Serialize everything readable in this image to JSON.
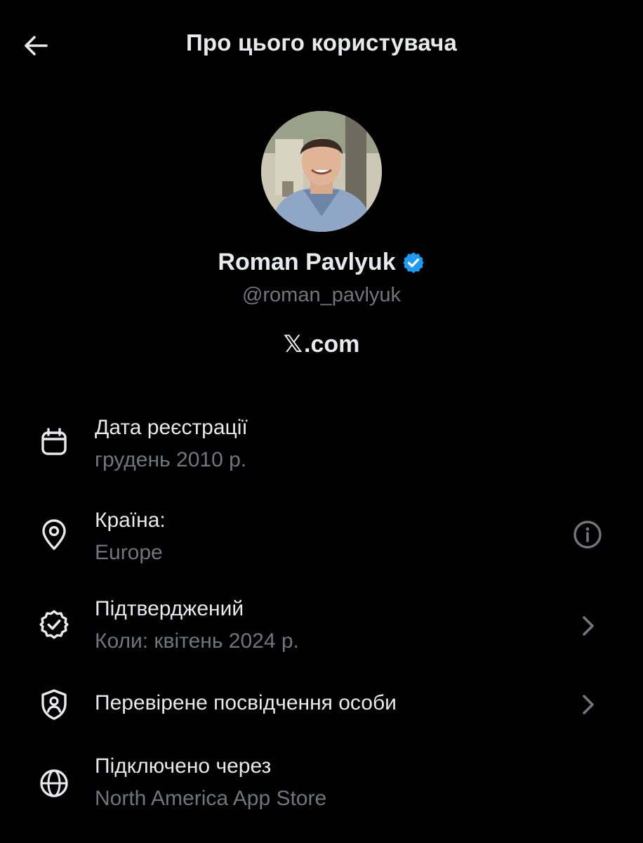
{
  "header": {
    "title": "Про цього користувача",
    "back_icon": "arrow-left-icon"
  },
  "profile": {
    "name": "Roman Pavlyuk",
    "verified_badge": "verified-checkmark-icon",
    "handle": "@roman_pavlyuk",
    "platform_logo": "𝕏",
    "platform_suffix": ".com"
  },
  "info": {
    "items": [
      {
        "icon": "calendar-icon",
        "title": "Дата реєстрації",
        "subtitle": "грудень 2010 р."
      },
      {
        "icon": "location-pin-icon",
        "title": "Країна:",
        "subtitle": "Europe",
        "action_icon": "info-icon"
      },
      {
        "icon": "verified-badge-icon",
        "title": "Підтверджений",
        "subtitle": "Коли: квітень 2024 р.",
        "action_icon": "chevron-right-icon"
      },
      {
        "icon": "id-shield-icon",
        "title": "Перевірене посвідчення особи",
        "action_icon": "chevron-right-icon"
      },
      {
        "icon": "globe-icon",
        "title": "Підключено через",
        "subtitle": "North America App Store"
      }
    ]
  },
  "colors": {
    "background": "#000000",
    "primary_text": "#e7e9ea",
    "secondary_text": "#71767b",
    "verified_blue": "#1d9bf0"
  }
}
